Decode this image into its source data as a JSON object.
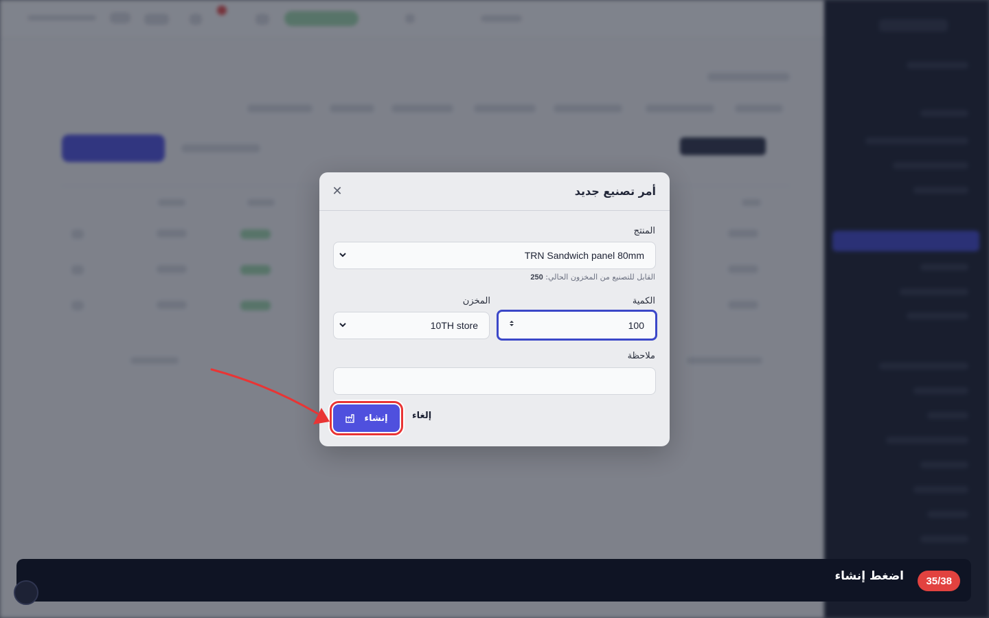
{
  "modal": {
    "title": "أمر تصنيع جديد",
    "product_label": "المنتج",
    "product_value": "TRN Sandwich panel 80mm",
    "available_text": "القابل للتصنيع من المخزون الحالي:",
    "available_value": "250",
    "quantity_label": "الكمية",
    "quantity_value": "100",
    "warehouse_label": "المخزن",
    "warehouse_value": "10TH store",
    "note_label": "ملاحظة",
    "note_value": "",
    "create_label": "إنشاء",
    "cancel_label": "إلغاء"
  },
  "tour": {
    "step": "35/38",
    "instruction": "اضغط إنشاء"
  },
  "colors": {
    "primary": "#4f50de",
    "highlight": "#e93434",
    "focus": "#3b47c8",
    "tour_bg": "#0f1424"
  },
  "icons": [
    "close-icon",
    "chevron-down-icon",
    "stepper-icon",
    "factory-icon",
    "arrow-pointer"
  ]
}
